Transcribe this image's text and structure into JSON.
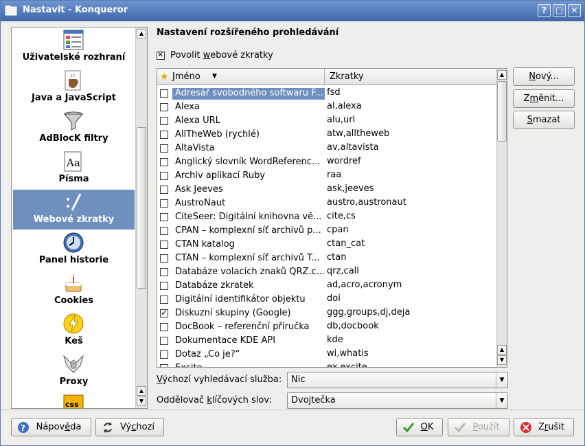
{
  "window": {
    "title": "Nastavit - Konqueror",
    "buttons": [
      "?",
      "□",
      "✕"
    ]
  },
  "sidebar": {
    "items": [
      {
        "label": "Uživatelské rozhraní",
        "icon": "ui-layout-icon"
      },
      {
        "label": "Java a JavaScript",
        "icon": "java-cup-icon"
      },
      {
        "label": "AdBlocK filtry",
        "icon": "funnel-filter-icon"
      },
      {
        "label": "Písma",
        "icon": "font-icon"
      },
      {
        "label": "Webové zkratky",
        "icon": "web-shortcut-icon",
        "selected": true
      },
      {
        "label": "Panel historie",
        "icon": "history-clock-icon"
      },
      {
        "label": "Cookies",
        "icon": "cake-icon"
      },
      {
        "label": "Keš",
        "icon": "lightning-cache-icon"
      },
      {
        "label": "Proxy",
        "icon": "proxy-network-icon"
      },
      {
        "label": "",
        "icon": "css-stylesheet-icon"
      }
    ]
  },
  "main": {
    "heading": "Nastavení rozšířeného prohledávání",
    "enable_checkbox": {
      "label_pre": "Povolit ",
      "label_u": "w",
      "label_post": "ebové zkratky",
      "checked": true
    },
    "table": {
      "col_name": "Jméno",
      "col_keys": "Zkratky",
      "rows": [
        {
          "name": "Adresář svobodného softwaru F...",
          "keys": "fsd",
          "checked": false,
          "selected": true
        },
        {
          "name": "Alexa",
          "keys": "al,alexa",
          "checked": false
        },
        {
          "name": "Alexa URL",
          "keys": "alu,url",
          "checked": false
        },
        {
          "name": "AllTheWeb (rychlé)",
          "keys": "atw,alltheweb",
          "checked": false
        },
        {
          "name": "AltaVista",
          "keys": "av,altavista",
          "checked": false
        },
        {
          "name": "Anglický slovník WordReferenc...",
          "keys": "wordref",
          "checked": false
        },
        {
          "name": "Archiv aplikací Ruby",
          "keys": "raa",
          "checked": false
        },
        {
          "name": "Ask Jeeves",
          "keys": "ask,jeeves",
          "checked": false
        },
        {
          "name": "AustroNaut",
          "keys": "austro,austronaut",
          "checked": false
        },
        {
          "name": "CiteSeer: Digitální knihovna vě...",
          "keys": "cite,cs",
          "checked": false
        },
        {
          "name": "CPAN – komplexní síť archivů p...",
          "keys": "cpan",
          "checked": false
        },
        {
          "name": "CTAN katalog",
          "keys": "ctan_cat",
          "checked": false
        },
        {
          "name": "CTAN – komplexní síť archivů T...",
          "keys": "ctan",
          "checked": false
        },
        {
          "name": "Databáze volacích znaků QRZ.c...",
          "keys": "qrz,call",
          "checked": false
        },
        {
          "name": "Databáze zkratek",
          "keys": "ad,acro,acronym",
          "checked": false
        },
        {
          "name": "Digitální identifikátor objektu",
          "keys": "doi",
          "checked": false
        },
        {
          "name": "Diskuzní skupiny (Google)",
          "keys": "ggg,groups,dj,deja",
          "checked": true
        },
        {
          "name": "DocBook – referenční příručka",
          "keys": "db,docbook",
          "checked": false
        },
        {
          "name": "Dokumentace KDE API",
          "keys": "kde",
          "checked": false
        },
        {
          "name": "Dotaz „Co je?“",
          "keys": "wi,whatis",
          "checked": false
        },
        {
          "name": "Excite",
          "keys": "ex,excite",
          "checked": false
        }
      ]
    },
    "buttons": {
      "new": {
        "pre": "",
        "u": "N",
        "post": "ový..."
      },
      "change": {
        "pre": "Z",
        "u": "m",
        "post": "ěnit..."
      },
      "delete": {
        "pre": "",
        "u": "S",
        "post": "mazat"
      }
    },
    "default_engine": {
      "label_pre": "",
      "label_u": "V",
      "label_post": "ýchozí vyhledávací služba:",
      "value": "Nic"
    },
    "delimiter": {
      "label_pre": "Oddělovač ",
      "label_u": "k",
      "label_post": "líčových slov:",
      "value": "Dvojtečka"
    }
  },
  "footer": {
    "help": {
      "pre": "Nápov",
      "u": "ě",
      "post": "da",
      "icon": "help-icon"
    },
    "defaults": {
      "pre": "Vý",
      "u": "c",
      "post": "hozí",
      "icon": "reset-icon"
    },
    "ok": {
      "pre": "",
      "u": "O",
      "post": "K",
      "icon": "checkmark-icon"
    },
    "apply": {
      "pre": "",
      "u": "P",
      "post": "oužít",
      "icon": "checkmark-icon",
      "disabled": true
    },
    "cancel": {
      "pre": "Z",
      "u": "r",
      "post": "ušit",
      "icon": "cancel-icon"
    }
  }
}
